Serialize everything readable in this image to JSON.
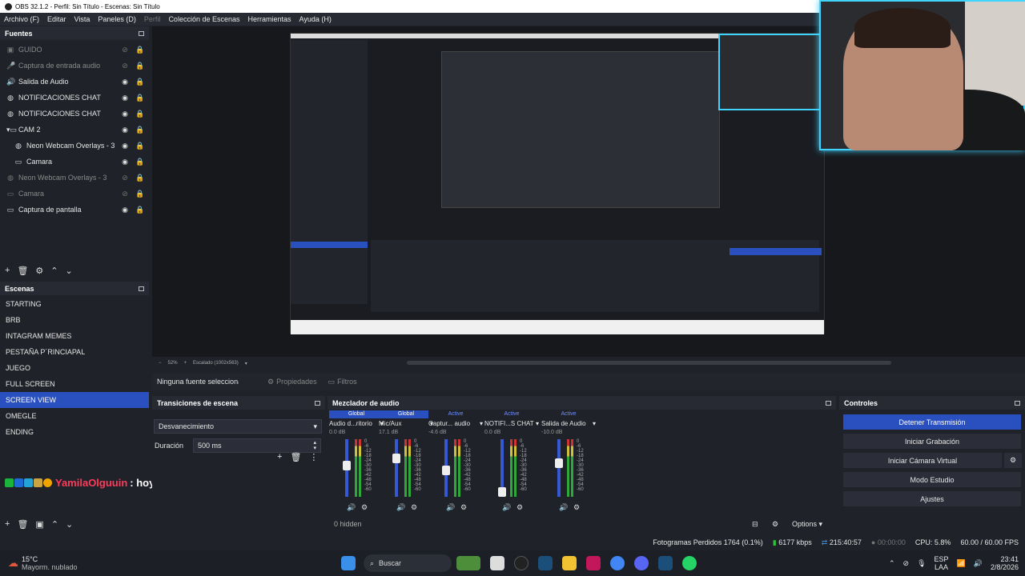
{
  "window": {
    "title": "OBS 32.1.2 - Perfil: Sin Título - Escenas: Sin Título"
  },
  "menu": {
    "items": [
      "Archivo (F)",
      "Editar",
      "Vista",
      "Paneles (D)",
      "Perfil",
      "Colección de Escenas",
      "Herramientas",
      "Ayuda (H)"
    ],
    "disabled": [
      false,
      false,
      false,
      false,
      true,
      false,
      false,
      false
    ]
  },
  "sources": {
    "title": "Fuentes",
    "items": [
      {
        "label": "GUIDO",
        "icon": "image-icon",
        "visible": false
      },
      {
        "label": "Captura de entrada audio",
        "icon": "microphone-icon",
        "visible": false
      },
      {
        "label": "Salida de Audio",
        "icon": "speaker-icon",
        "visible": true
      },
      {
        "label": "NOTIFICACIONES CHAT",
        "icon": "globe-icon",
        "visible": true
      },
      {
        "label": "NOTIFICACIONES CHAT",
        "icon": "globe-icon",
        "visible": true
      },
      {
        "label": "CAM 2",
        "icon": "folder-icon",
        "visible": true
      },
      {
        "label": "Neon Webcam Overlays - 3",
        "icon": "globe-icon",
        "visible": true
      },
      {
        "label": "Camara",
        "icon": "camera-icon",
        "visible": true
      },
      {
        "label": "Neon Webcam Overlays - 3",
        "icon": "globe-icon",
        "visible": false
      },
      {
        "label": "Camara",
        "icon": "camera-icon",
        "visible": false
      },
      {
        "label": "Captura de pantalla",
        "icon": "monitor-icon",
        "visible": true
      }
    ]
  },
  "scenes": {
    "title": "Escenas",
    "items": [
      "STARTING",
      "BRB",
      "INTAGRAM MEMES",
      "PESTAÑA P´RINCIAPAL",
      "JUEGO",
      "FULL SCREEN",
      "SCREEN VIEW",
      "OMEGLE",
      "ENDING"
    ],
    "selected": "SCREEN VIEW"
  },
  "chat": {
    "user": "YamilaOlguuin",
    "message": ": hoy se duerme temprano?"
  },
  "preview": {
    "zoom": "52%",
    "scale": "Escalado (1002x563)"
  },
  "source_bar": {
    "none_selected": "Ninguna fuente seleccionada",
    "properties": "Propiedades",
    "filters": "Filtros"
  },
  "transitions": {
    "title": "Transiciones de escena",
    "selected": "Desvanecimiento",
    "duration_label": "Duración",
    "duration": "500 ms"
  },
  "mixer": {
    "title": "Mezclador de audio",
    "channels": [
      {
        "tag": "Global",
        "name": "Audio d...ritorio",
        "db": "0.0 dB",
        "level": 0.55,
        "muted": false
      },
      {
        "tag": "Global",
        "name": "Mic/Aux",
        "db": "17.1 dB",
        "level": 0.7,
        "muted": false
      },
      {
        "tag": "Active",
        "name": "Captur... audio",
        "db": "-4.6 dB",
        "level": 0.45,
        "muted": true
      },
      {
        "tag": "Active",
        "name": "NOTIFI...S CHAT",
        "db": "0.0 dB",
        "level": 0.0,
        "muted": false
      },
      {
        "tag": "Active",
        "name": "Salida de Audio",
        "db": "-10.0 dB",
        "level": 0.6,
        "muted": false
      }
    ],
    "scale": [
      "0",
      "-6",
      "-12",
      "-18",
      "-24",
      "-30",
      "-36",
      "-42",
      "-48",
      "-54",
      "-60"
    ],
    "hidden": "0 hidden",
    "options": "Options"
  },
  "controls": {
    "title": "Controles",
    "buttons": [
      "Detener Transmisión",
      "Iniciar Grabación",
      "Iniciar Cámara Virtual",
      "Modo Estudio",
      "Ajustes"
    ]
  },
  "status": {
    "dropped": "Fotogramas Perdidos 1764 (0.1%)",
    "bitrate": "6177 kbps",
    "stream_time": "215:40:57",
    "rec_time": "00:00:00",
    "cpu": "CPU: 5.8%",
    "fps": "60.00 / 60.00 FPS"
  },
  "taskbar": {
    "weather_temp": "15°C",
    "weather_desc": "Mayorm. nublado",
    "search": "Buscar",
    "lang": "ESP",
    "lang2": "LAA",
    "time": "23:41",
    "date": "2/8/2026"
  },
  "colors": {
    "accent": "#2a4fbf",
    "live": "#3fd3ff",
    "chat_user": "#ff3a5a"
  }
}
